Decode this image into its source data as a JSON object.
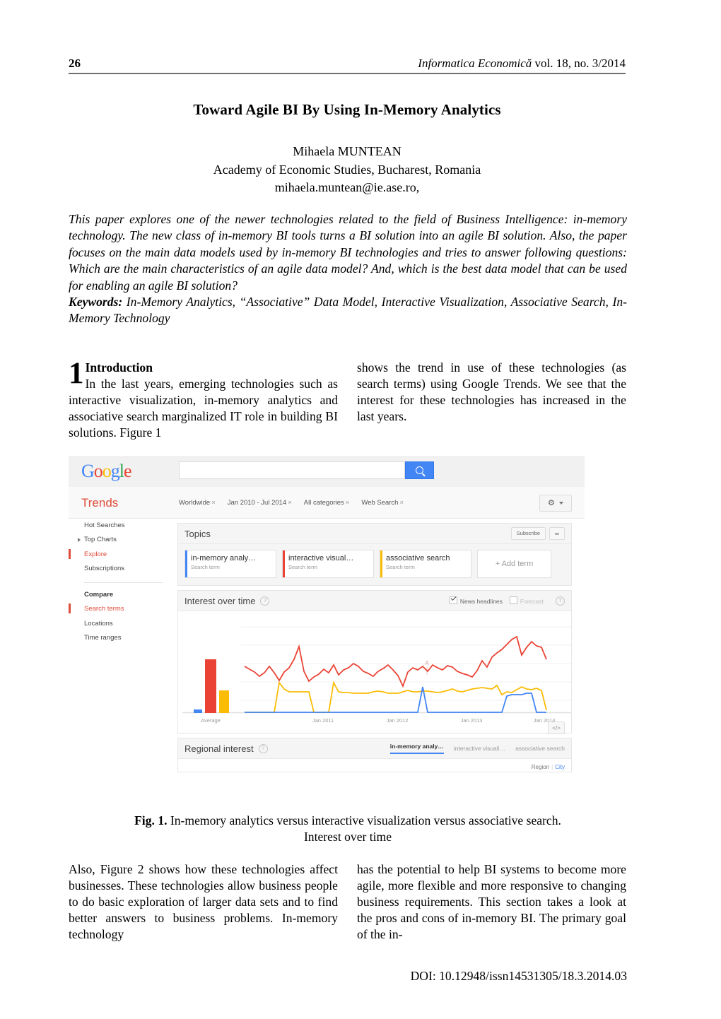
{
  "running_head": {
    "page_number": "26",
    "journal_italic": "Informatica Economică",
    "journal_rest": " vol. 18, no. 3/2014"
  },
  "title": "Toward Agile BI By Using In-Memory Analytics",
  "authors": {
    "name": "Mihaela MUNTEAN",
    "affiliation": "Academy of Economic Studies, Bucharest, Romania",
    "email": "mihaela.muntean@ie.ase.ro,"
  },
  "abstract": {
    "body": "This paper explores one of the newer technologies related to the field of Business Intelligence: in-memory technology. The new class of in-memory BI tools turns a BI solution into an agile BI solution. Also, the paper focuses on the main data models used by in-memory BI technologies and tries to answer following questions: Which are the main characteristics of an agile data model? And, which is the best data model that can be used for enabling an agile BI solution?",
    "keywords_label": "Keywords:",
    "keywords": " In-Memory Analytics, “Associative” Data Model, Interactive Visualization, Associative Search, In-Memory Technology"
  },
  "body_top": {
    "dropcap": "1",
    "section_heading": "Introduction",
    "left_text": "In the last years, emerging technologies such as interactive visualization, in-memory analytics and associative search marginalized IT role in building BI solutions. Figure 1",
    "right_text": "shows the trend in use of these technologies (as search terms) using Google Trends. We see that the interest for these technologies has increased in the last years."
  },
  "figure": {
    "caption_label": "Fig. 1.",
    "caption_text": " In-memory analytics versus interactive visualization versus associative search.",
    "caption_line2": "Interest over time",
    "google_logo": [
      "G",
      "o",
      "o",
      "g",
      "l",
      "e"
    ],
    "search_value": "",
    "search_placeholder": "",
    "search_icon": "search-icon",
    "trends_label": "Trends",
    "chips": [
      {
        "label": "Worldwide",
        "remove": "×"
      },
      {
        "label": "Jan 2010 - Jul 2014",
        "remove": "×"
      },
      {
        "label": "All categories",
        "remove": "×"
      },
      {
        "label": "Web Search",
        "remove": "×"
      }
    ],
    "gear_icon": "gear-icon",
    "sidebar": {
      "items": [
        {
          "label": "Hot Searches",
          "active": false,
          "arrow": false
        },
        {
          "label": "Top Charts",
          "active": false,
          "arrow": true
        },
        {
          "label": "Explore",
          "active": true,
          "arrow": false
        },
        {
          "label": "Subscriptions",
          "active": false,
          "arrow": false
        }
      ],
      "compare_heading": "Compare",
      "compare_items": [
        {
          "label": "Search terms",
          "active": true
        },
        {
          "label": "Locations",
          "active": false
        },
        {
          "label": "Time ranges",
          "active": false
        }
      ]
    },
    "topics_panel": {
      "title": "Topics",
      "subscribe_label": "Subscribe",
      "share_icon": "share-icon",
      "terms": [
        {
          "name": "in-memory analy…",
          "sub": "Search term",
          "color": "#4285f4"
        },
        {
          "name": "interactive visual…",
          "sub": "Search term",
          "color": "#ea4335"
        },
        {
          "name": "associative search",
          "sub": "Search term",
          "color": "#fbbc05"
        }
      ],
      "add_term_label": "+ Add term"
    },
    "interest_panel": {
      "title": "Interest over time",
      "help_icon": "help-icon",
      "news_headlines_label": "News headlines",
      "news_headlines_checked": true,
      "forecast_label": "Forecast",
      "forecast_checked": false,
      "embed_icon": "code-embed-icon",
      "embed_label": "</>",
      "annotation_marker": "A"
    },
    "regional_panel": {
      "title": "Regional interest",
      "help_icon": "help-icon",
      "tabs": [
        {
          "label": "in-memory analy…",
          "active": true
        },
        {
          "label": "interactive visuali…",
          "active": false
        },
        {
          "label": "associative search",
          "active": false
        }
      ],
      "region_label": "Region",
      "city_label": "City"
    }
  },
  "chart_data": {
    "type": "line",
    "title": "Interest over time",
    "xlabel": "",
    "ylabel": "",
    "ylim": [
      0,
      100
    ],
    "grid": true,
    "legend_position": "top-cards",
    "average_bars": {
      "label": "Average",
      "values": [
        3,
        57,
        22
      ],
      "colors": [
        "#4285f4",
        "#ea4335",
        "#fbbc05"
      ]
    },
    "x_tick_labels": [
      "Jan 2011",
      "Jan 2012",
      "Jan 2013",
      "Jan 2014"
    ],
    "x_tick_positions": [
      0.25,
      0.47,
      0.69,
      0.91
    ],
    "annotations": [
      {
        "label": "A",
        "x": 0.555,
        "y": 52
      }
    ],
    "series": [
      {
        "name": "in-memory analy…",
        "color": "#4285f4",
        "values": [
          0,
          0,
          0,
          0,
          0,
          0,
          0,
          0,
          0,
          0,
          0,
          0,
          0,
          0,
          0,
          0,
          0,
          0,
          0,
          0,
          0,
          0,
          0,
          0,
          0,
          0,
          0,
          0,
          0,
          0,
          0,
          0,
          0,
          0,
          0,
          0,
          28,
          0,
          0,
          0,
          0,
          0,
          0,
          0,
          0,
          0,
          0,
          0,
          0,
          0,
          0,
          0,
          0,
          18,
          20,
          20,
          20,
          21,
          21,
          0,
          0,
          0
        ]
      },
      {
        "name": "interactive visual…",
        "color": "#ea4335",
        "values": [
          50,
          47,
          44,
          40,
          43,
          50,
          43,
          36,
          44,
          49,
          57,
          68,
          45,
          35,
          39,
          42,
          47,
          43,
          51,
          40,
          45,
          47,
          52,
          49,
          44,
          42,
          40,
          44,
          47,
          50,
          45,
          39,
          30,
          43,
          47,
          45,
          48,
          44,
          50,
          47,
          45,
          49,
          48,
          44,
          42,
          41,
          39,
          45,
          55,
          48,
          58,
          62,
          65,
          70,
          74,
          77,
          60,
          66,
          72,
          68,
          67,
          57
        ]
      },
      {
        "name": "associative search",
        "color": "#fbbc05",
        "values": [
          0,
          0,
          0,
          0,
          0,
          0,
          0,
          32,
          26,
          22,
          22,
          22,
          22,
          22,
          0,
          0,
          0,
          0,
          32,
          22,
          21,
          21,
          20,
          20,
          20,
          20,
          22,
          23,
          22,
          20,
          20,
          20,
          22,
          24,
          22,
          22,
          23,
          23,
          22,
          21,
          22,
          24,
          26,
          23,
          22,
          24,
          26,
          27,
          28,
          27,
          26,
          30,
          20,
          22,
          21,
          25,
          29,
          26,
          25,
          27,
          24,
          2
        ]
      }
    ]
  },
  "body_bottom": {
    "left_text": "Also, Figure 2 shows how these technologies affect businesses. These technologies allow business people to do basic exploration of larger data sets and to find better answers to business problems. In-memory technology",
    "right_text": "has the potential to help BI systems to become more agile, more flexible and more responsive to changing business requirements. This section takes a look at the pros and cons of in-memory BI. The primary goal of the in-"
  },
  "doi": "DOI: 10.12948/issn14531305/18.3.2014.03"
}
